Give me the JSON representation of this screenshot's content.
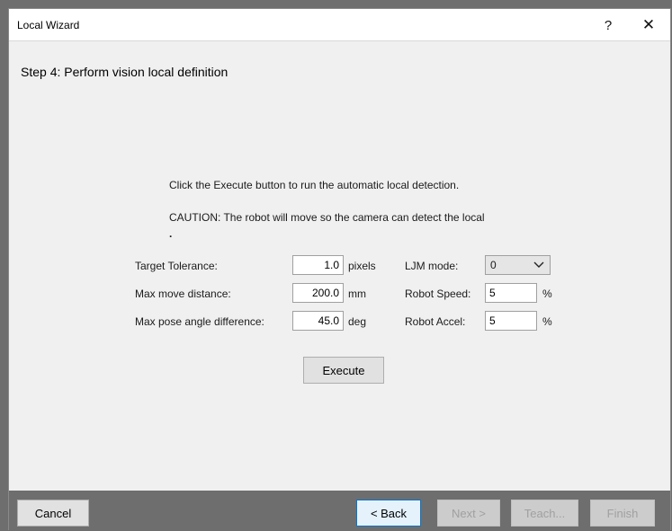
{
  "window": {
    "title": "Local Wizard",
    "help_glyph": "?",
    "close_glyph": "✕"
  },
  "step": {
    "title": "Step 4: Perform vision local definition"
  },
  "messages": {
    "line1": "Click the Execute button to run the automatic local detection.",
    "line2": "CAUTION: The robot will move so the camera can detect the local",
    "line3": "."
  },
  "fields": {
    "target_tolerance": {
      "label": "Target Tolerance:",
      "value": "1.0",
      "unit": "pixels"
    },
    "max_move_distance": {
      "label": "Max move distance:",
      "value": "200.0",
      "unit": "mm"
    },
    "max_pose_angle": {
      "label": "Max pose angle difference:",
      "value": "45.0",
      "unit": "deg"
    },
    "ljm_mode": {
      "label": "LJM mode:",
      "value": "0"
    },
    "robot_speed": {
      "label": "Robot Speed:",
      "value": "5",
      "unit": "%"
    },
    "robot_accel": {
      "label": "Robot Accel:",
      "value": "5",
      "unit": "%"
    }
  },
  "buttons": {
    "execute": "Execute",
    "cancel": "Cancel",
    "back": "< Back",
    "next": "Next >",
    "teach": "Teach...",
    "finish": "Finish"
  },
  "icons": {
    "help": "help-icon",
    "close": "close-icon",
    "dropdown": "chevron-down-icon"
  }
}
